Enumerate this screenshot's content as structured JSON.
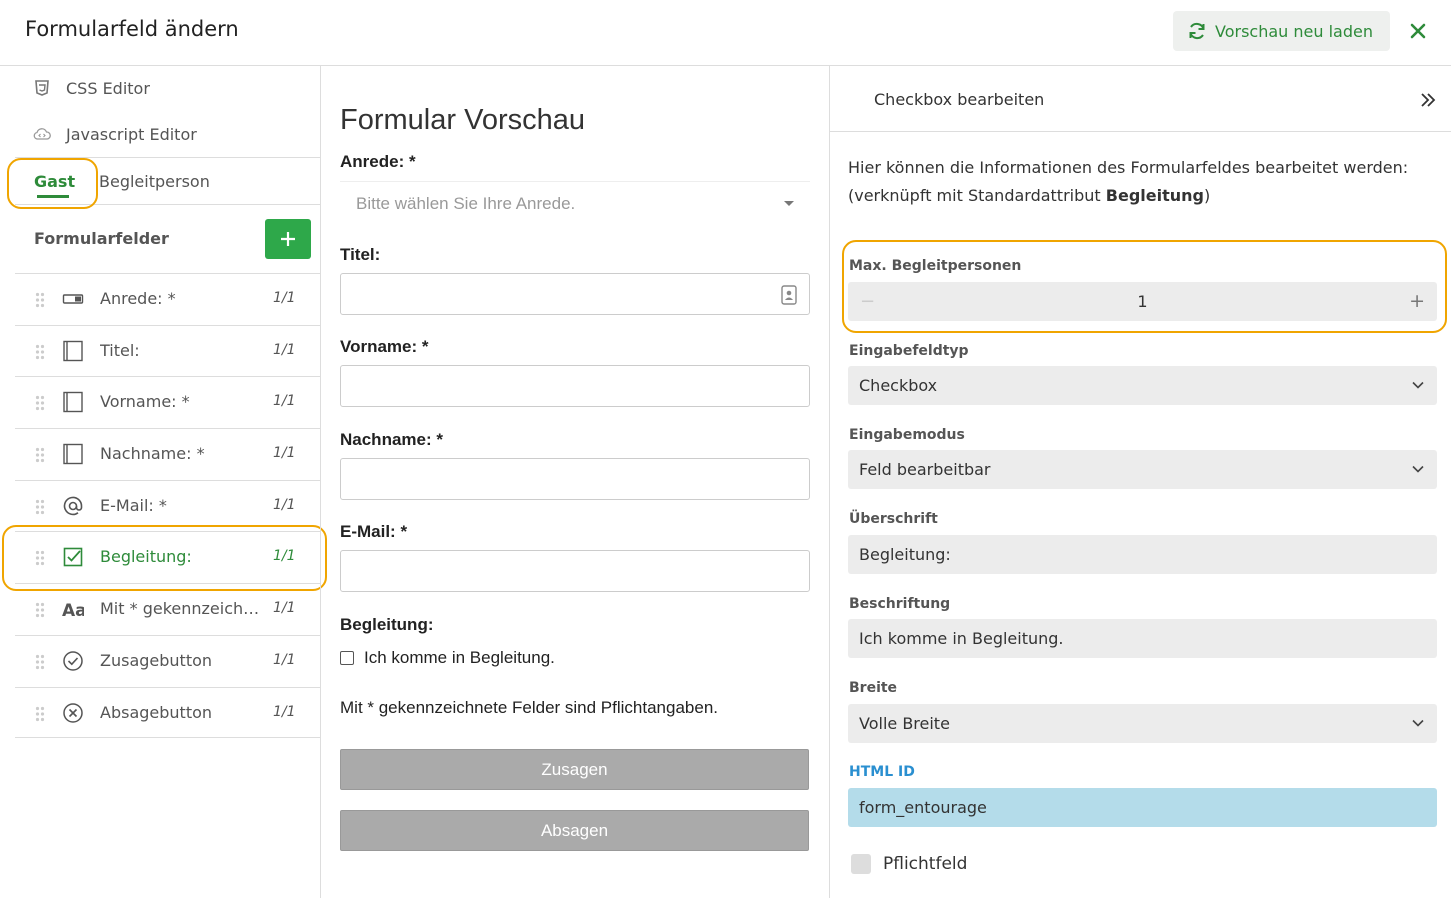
{
  "header": {
    "title": "Formularfeld ändern",
    "reload_label": "Vorschau neu laden"
  },
  "sidebar": {
    "css_editor": "CSS Editor",
    "js_editor": "Javascript Editor",
    "tabs": [
      "Gast",
      "Begleitperson"
    ],
    "section_title": "Formularfelder",
    "fields": [
      {
        "label": "Anrede: *",
        "ratio": "1/1",
        "icon": "select-icon"
      },
      {
        "label": "Titel:",
        "ratio": "1/1",
        "icon": "textfield-icon"
      },
      {
        "label": "Vorname: *",
        "ratio": "1/1",
        "icon": "textfield-icon"
      },
      {
        "label": "Nachname: *",
        "ratio": "1/1",
        "icon": "textfield-icon"
      },
      {
        "label": "E-Mail: *",
        "ratio": "1/1",
        "icon": "at-icon"
      },
      {
        "label": "Begleitung:",
        "ratio": "1/1",
        "icon": "checkbox-icon"
      },
      {
        "label": "Mit * gekennzeichnete Felder sind Pflichtangaben.",
        "ratio": "1/1",
        "icon": "text-icon"
      },
      {
        "label": "Zusagebutton",
        "ratio": "1/1",
        "icon": "check-circle-icon"
      },
      {
        "label": "Absagebutton",
        "ratio": "1/1",
        "icon": "x-circle-icon"
      }
    ]
  },
  "preview": {
    "title": "Formular Vorschau",
    "anrede_label": "Anrede: *",
    "anrede_placeholder": "Bitte wählen Sie Ihre Anrede.",
    "titel_label": "Titel:",
    "vorname_label": "Vorname: *",
    "nachname_label": "Nachname: *",
    "email_label": "E-Mail: *",
    "begleitung_label": "Begleitung:",
    "begleitung_checkbox": "Ich komme in Begleitung.",
    "note": "Mit * gekennzeichnete Felder sind Pflichtangaben.",
    "accept_label": "Zusagen",
    "decline_label": "Absagen"
  },
  "panel": {
    "title": "Checkbox bearbeiten",
    "description_text": "Hier können die Informationen des Formularfeldes bearbeitet werden: (verknüpft mit Standardattribut ",
    "description_bold": "Begleitung",
    "description_end": ")",
    "max_label": "Max. Begleitpersonen",
    "max_value": "1",
    "type_label": "Eingabefeldtyp",
    "type_value": "Checkbox",
    "mode_label": "Eingabemodus",
    "mode_value": "Feld bearbeitbar",
    "heading_label": "Überschrift",
    "heading_value": "Begleitung:",
    "caption_label": "Beschriftung",
    "caption_value": "Ich komme in Begleitung.",
    "width_label": "Breite",
    "width_value": "Volle Breite",
    "htmlid_label": "HTML ID",
    "htmlid_value": "form_entourage",
    "required_label": "Pflichtfeld"
  },
  "colors": {
    "accent": "#2e8b3a",
    "highlight": "#f0a500",
    "htmlid_bg": "#b4dcea"
  }
}
